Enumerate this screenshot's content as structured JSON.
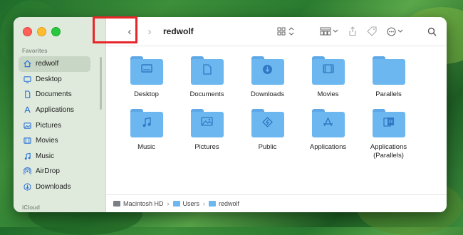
{
  "window": {
    "title": "redwolf",
    "colors": {
      "accent": "#2a73d9",
      "folder": "#6db7f0",
      "highlight": "#e8262a"
    }
  },
  "sidebar": {
    "favorites_label": "Favorites",
    "icloud_label": "iCloud",
    "items": [
      {
        "label": "redwolf",
        "icon": "home-icon"
      },
      {
        "label": "Desktop",
        "icon": "desktop-icon"
      },
      {
        "label": "Documents",
        "icon": "document-icon"
      },
      {
        "label": "Applications",
        "icon": "applications-icon"
      },
      {
        "label": "Pictures",
        "icon": "pictures-icon"
      },
      {
        "label": "Movies",
        "icon": "movies-icon"
      },
      {
        "label": "Music",
        "icon": "music-icon"
      },
      {
        "label": "AirDrop",
        "icon": "airdrop-icon"
      },
      {
        "label": "Downloads",
        "icon": "downloads-icon"
      }
    ]
  },
  "toolbar": {
    "back": "‹",
    "forward": "›",
    "view": "⊞",
    "sort": "⌃",
    "group": "▤",
    "group_chevron": "⌄",
    "share": "⇧",
    "tag": "◇",
    "more": "⊙",
    "more_chevron": "⌄",
    "search": "⌕"
  },
  "folders": [
    {
      "label": "Desktop",
      "glyph": "▭"
    },
    {
      "label": "Documents",
      "glyph": "▯"
    },
    {
      "label": "Downloads",
      "glyph": "⬇"
    },
    {
      "label": "Movies",
      "glyph": "▦"
    },
    {
      "label": "Parallels",
      "glyph": ""
    },
    {
      "label": "Music",
      "glyph": "♫"
    },
    {
      "label": "Pictures",
      "glyph": "▣"
    },
    {
      "label": "Public",
      "glyph": "⚡"
    },
    {
      "label": "Applications",
      "glyph": "A"
    },
    {
      "label": "Applications (Parallels)",
      "glyph": "▥"
    }
  ],
  "pathbar": {
    "segments": [
      "Macintosh HD",
      "Users",
      "redwolf"
    ],
    "separator": "›"
  }
}
